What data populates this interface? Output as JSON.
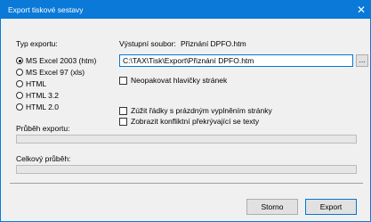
{
  "window": {
    "title": "Export tiskové sestavy",
    "close_glyph": "✕"
  },
  "export_type": {
    "label": "Typ exportu:",
    "options": [
      {
        "label": "MS Excel 2003 (htm)",
        "selected": true
      },
      {
        "label": "MS Excel  97 (xls)",
        "selected": false
      },
      {
        "label": "HTML",
        "selected": false
      },
      {
        "label": "HTML 3.2",
        "selected": false
      },
      {
        "label": "HTML 2.0",
        "selected": false
      }
    ]
  },
  "output_file": {
    "label": "Výstupní soubor:",
    "name": "Přiznání DPFO.htm",
    "path": "C:\\TAX\\Tisk\\Export\\Přiznání DPFO.htm",
    "browse_label": "..."
  },
  "options": {
    "no_repeat_headers": "Neopakovat hlavičky stránek",
    "shrink_rows": "Zúžit řádky s prázdným vyplněním stránky",
    "show_overlapping": "Zobrazit konfliktní překrývající se texty"
  },
  "progress": {
    "export_label": "Průběh exportu:",
    "export_value": 0,
    "total_label": "Celkový průběh:",
    "total_value": 0
  },
  "buttons": {
    "cancel": "Storno",
    "export": "Export"
  }
}
